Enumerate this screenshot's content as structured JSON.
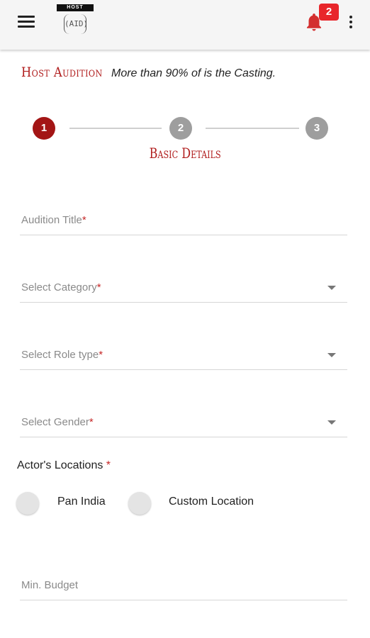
{
  "header": {
    "menu_icon": "hamburger-menu-icon",
    "logo_top_text": "HOST",
    "logo_main_text": "(AID)",
    "notification_icon": "bell-icon",
    "notification_count": "2",
    "overflow_icon": "more-vert-icon",
    "bell_color": "#d32f2f",
    "badge_color": "#e8262b"
  },
  "page": {
    "title": "Host Audition",
    "tagline": "More than 90% of is the Casting."
  },
  "stepper": {
    "steps": [
      "1",
      "2",
      "3"
    ],
    "active_step": 1,
    "active_label": "Basic Details",
    "active_color": "#a31515",
    "inactive_color": "#9e9e9e"
  },
  "form": {
    "audition_title": {
      "placeholder": "Audition Title",
      "required_mark": "*"
    },
    "category": {
      "placeholder": "Select Category",
      "required_mark": "*",
      "icon": "dropdown-arrow-icon"
    },
    "role_type": {
      "placeholder": "Select Role type",
      "required_mark": "*",
      "icon": "dropdown-arrow-icon"
    },
    "gender": {
      "placeholder": "Select Gender",
      "required_mark": "*",
      "icon": "dropdown-arrow-icon"
    },
    "locations": {
      "label": "Actor's Locations",
      "required_mark": "*",
      "options": [
        "Pan India",
        "Custom Location"
      ]
    },
    "min_budget": {
      "placeholder": "Min. Budget"
    }
  }
}
